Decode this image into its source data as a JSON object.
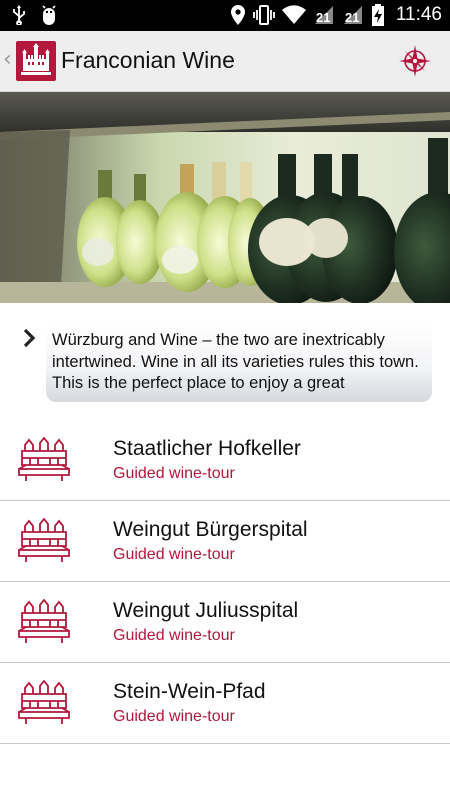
{
  "status_bar": {
    "time": "11:46",
    "icons": [
      "usb-icon",
      "android-debug-icon",
      "location-icon",
      "vibrate-icon",
      "wifi-icon",
      "signal-icon",
      "signal-icon",
      "battery-charging-icon"
    ]
  },
  "app_bar": {
    "title": "Franconian Wine",
    "logo_icon": "fortress-logo-icon",
    "action_icon": "compass-icon"
  },
  "intro": {
    "text": "Würzburg and Wine – the two are inextricably intertwined. Wine in all its varieties rules this town. This is the perfect place to enjoy a great"
  },
  "venues": [
    {
      "name": "Staatlicher Hofkeller",
      "subtitle": "Guided wine-tour"
    },
    {
      "name": "Weingut Bürgerspital",
      "subtitle": "Guided wine-tour"
    },
    {
      "name": "Weingut Juliusspital",
      "subtitle": "Guided wine-tour"
    },
    {
      "name": "Stein-Wein-Pfad",
      "subtitle": "Guided wine-tour"
    }
  ],
  "colors": {
    "accent": "#b3173b",
    "app_bar_bg": "#eeeeee",
    "status_bar_bg": "#000000"
  }
}
